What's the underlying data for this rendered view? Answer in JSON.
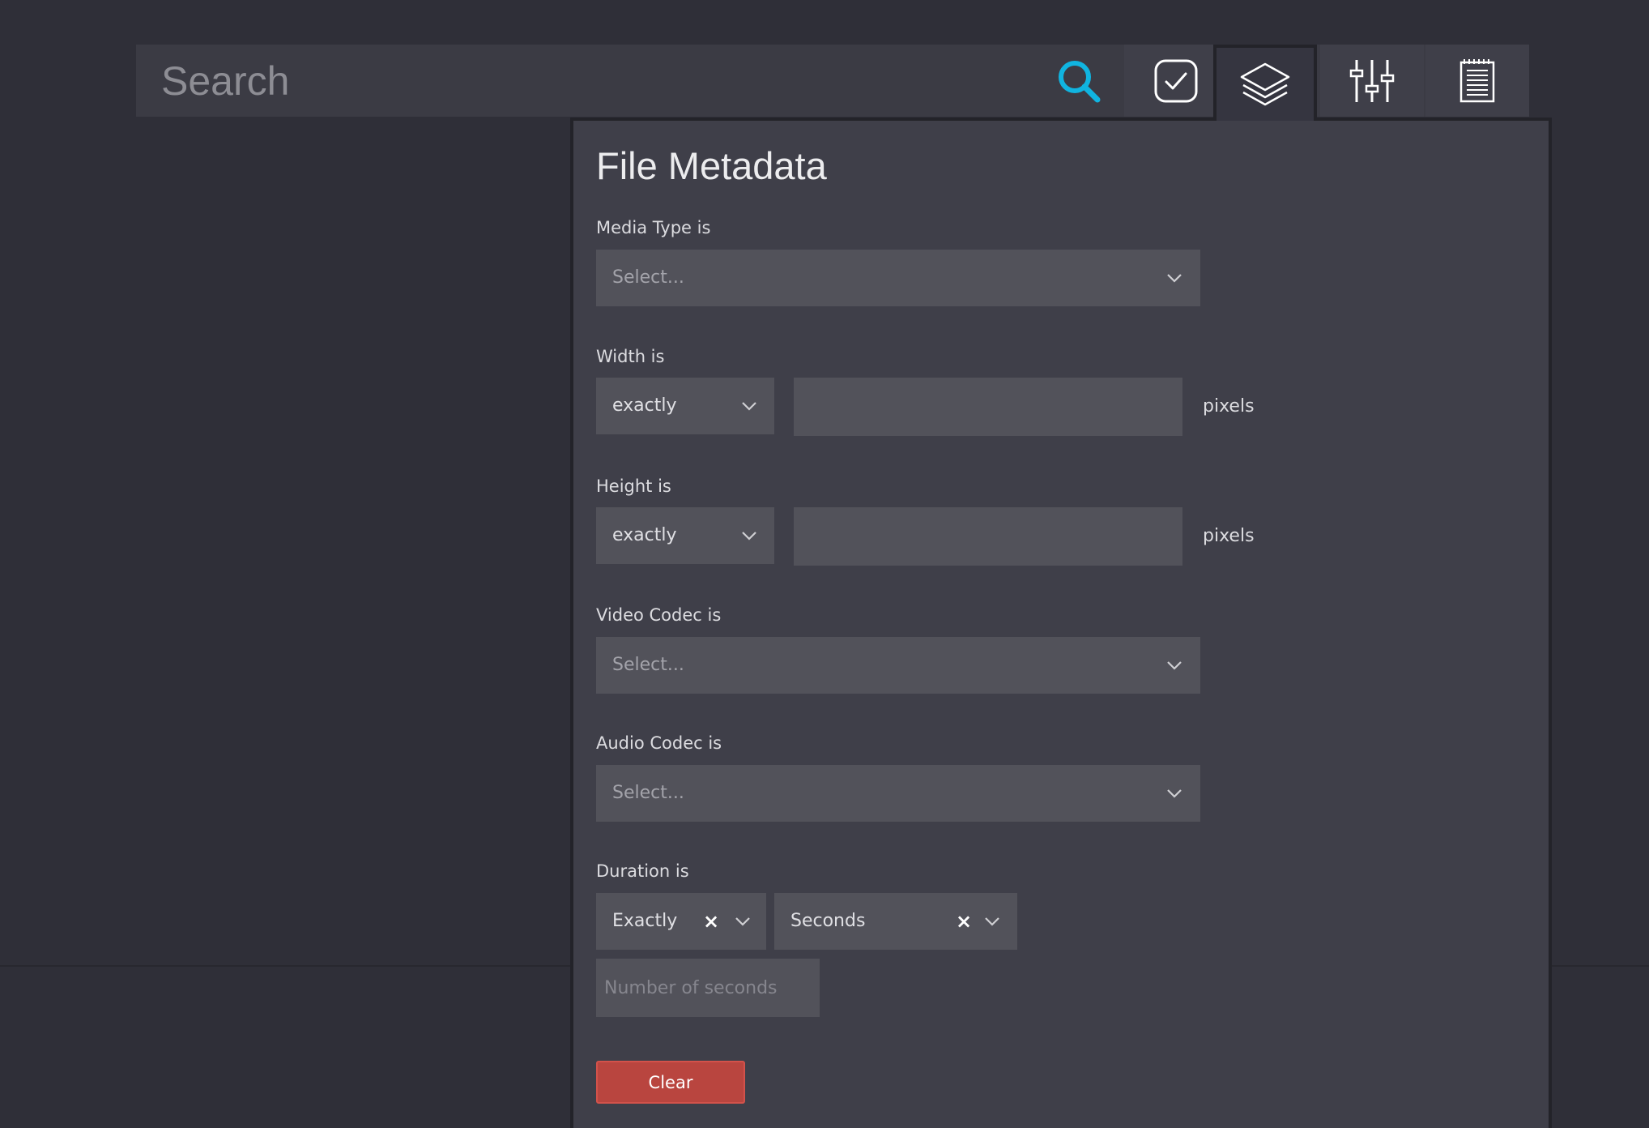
{
  "search": {
    "placeholder": "Search"
  },
  "toolbar": {
    "icons": [
      "search-icon",
      "checkbox-icon",
      "layers-icon",
      "sliders-icon",
      "notepad-icon"
    ],
    "active": "layers-icon",
    "accent_color": "#10b4e0"
  },
  "panel": {
    "title": "File Metadata",
    "media_type": {
      "label": "Media Type is",
      "placeholder": "Select..."
    },
    "width": {
      "label": "Width is",
      "operator": "exactly",
      "value": "",
      "unit": "pixels"
    },
    "height": {
      "label": "Height is",
      "operator": "exactly",
      "value": "",
      "unit": "pixels"
    },
    "video_codec": {
      "label": "Video Codec is",
      "placeholder": "Select..."
    },
    "audio_codec": {
      "label": "Audio Codec is",
      "placeholder": "Select..."
    },
    "duration": {
      "label": "Duration is",
      "operator": "Exactly",
      "unit": "Seconds",
      "clear_symbol": "×",
      "value_placeholder": "Number of seconds"
    },
    "clear_label": "Clear",
    "clear_color": "#b9453f"
  }
}
